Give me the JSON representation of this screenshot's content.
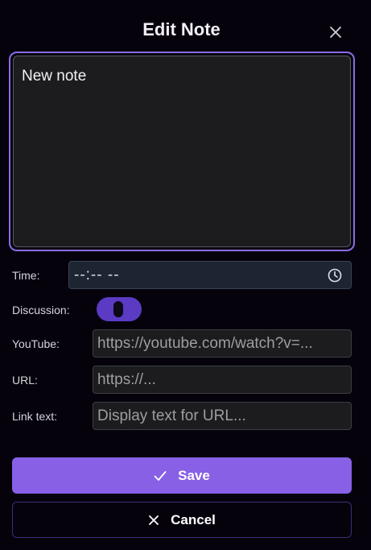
{
  "dialog": {
    "title": "Edit Note",
    "close_icon": "close-icon"
  },
  "note": {
    "value": "New note"
  },
  "form": {
    "time": {
      "label": "Time:",
      "value": "--:-- --",
      "icon": "clock-icon"
    },
    "discussion": {
      "label": "Discussion:",
      "enabled": true
    },
    "youtube": {
      "label": "YouTube:",
      "placeholder": "https://youtube.com/watch?v=..."
    },
    "url": {
      "label": "URL:",
      "placeholder": "https://..."
    },
    "link_text": {
      "label": "Link text:",
      "placeholder": "Display text for URL..."
    }
  },
  "actions": {
    "save_label": "Save",
    "save_icon": "check-icon",
    "cancel_label": "Cancel",
    "cancel_icon": "close-icon"
  },
  "colors": {
    "accent": "#8760e6",
    "toggle_on": "#5b3ac4",
    "background": "#05020c",
    "field": "#1c1c1e"
  }
}
